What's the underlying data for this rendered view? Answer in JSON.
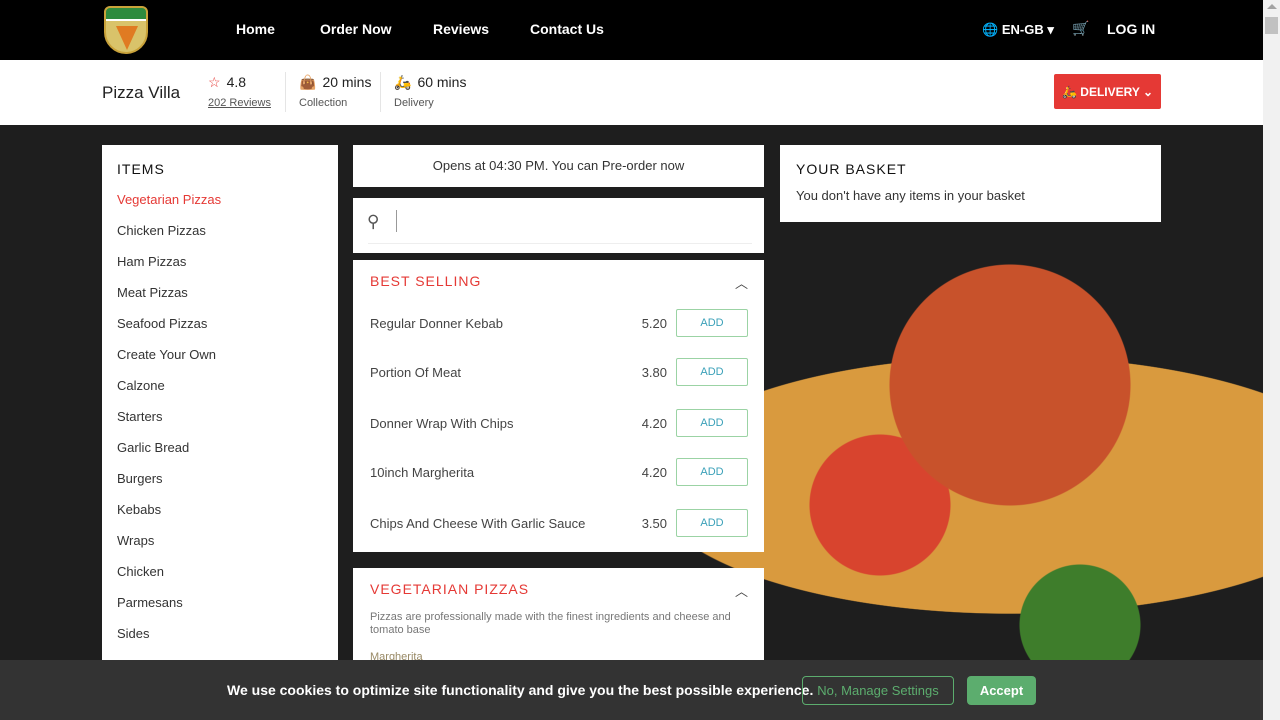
{
  "nav": {
    "brand": "PIZZA VILLA",
    "links": [
      "Home",
      "Order Now",
      "Reviews",
      "Contact Us"
    ],
    "language": "EN-GB",
    "login": "LOG IN"
  },
  "info": {
    "name": "Pizza Villa",
    "rating": "4.8",
    "reviews": "202 Reviews",
    "collection_time": "20 mins",
    "collection_label": "Collection",
    "delivery_time": "60 mins",
    "delivery_label": "Delivery",
    "mode_button": "DELIVERY"
  },
  "sidebar": {
    "title": "ITEMS",
    "items": [
      "Vegetarian Pizzas",
      "Chicken Pizzas",
      "Ham Pizzas",
      "Meat Pizzas",
      "Seafood Pizzas",
      "Create Your Own",
      "Calzone",
      "Starters",
      "Garlic Bread",
      "Burgers",
      "Kebabs",
      "Wraps",
      "Chicken",
      "Parmesans",
      "Sides"
    ]
  },
  "menu": {
    "opens": "Opens at 04:30 PM. You can Pre-order now",
    "search_value": "",
    "best_selling": {
      "title": "BEST SELLING",
      "items": [
        {
          "name": "Regular Donner Kebab",
          "price": "5.20"
        },
        {
          "name": "Portion Of Meat",
          "price": "3.80"
        },
        {
          "name": "Donner Wrap With Chips",
          "price": "4.20"
        },
        {
          "name": "10inch Margherita",
          "price": "4.20"
        },
        {
          "name": "Chips And Cheese With Garlic Sauce",
          "price": "3.50"
        }
      ]
    },
    "add_label": "ADD",
    "vegetarian": {
      "title": "VEGETARIAN PIZZAS",
      "description": "Pizzas are professionally made with the finest ingredients and cheese and tomato base",
      "first_item": "Margherita"
    }
  },
  "basket": {
    "title": "YOUR BASKET",
    "empty": "You don't have any items in your basket"
  },
  "cookie": {
    "text": "We use cookies to optimize site functionality and give you the best possible experience.",
    "manage": "No, Manage Settings",
    "accept": "Accept"
  },
  "colors": {
    "accent": "#e53935",
    "green": "#5cad6e"
  }
}
